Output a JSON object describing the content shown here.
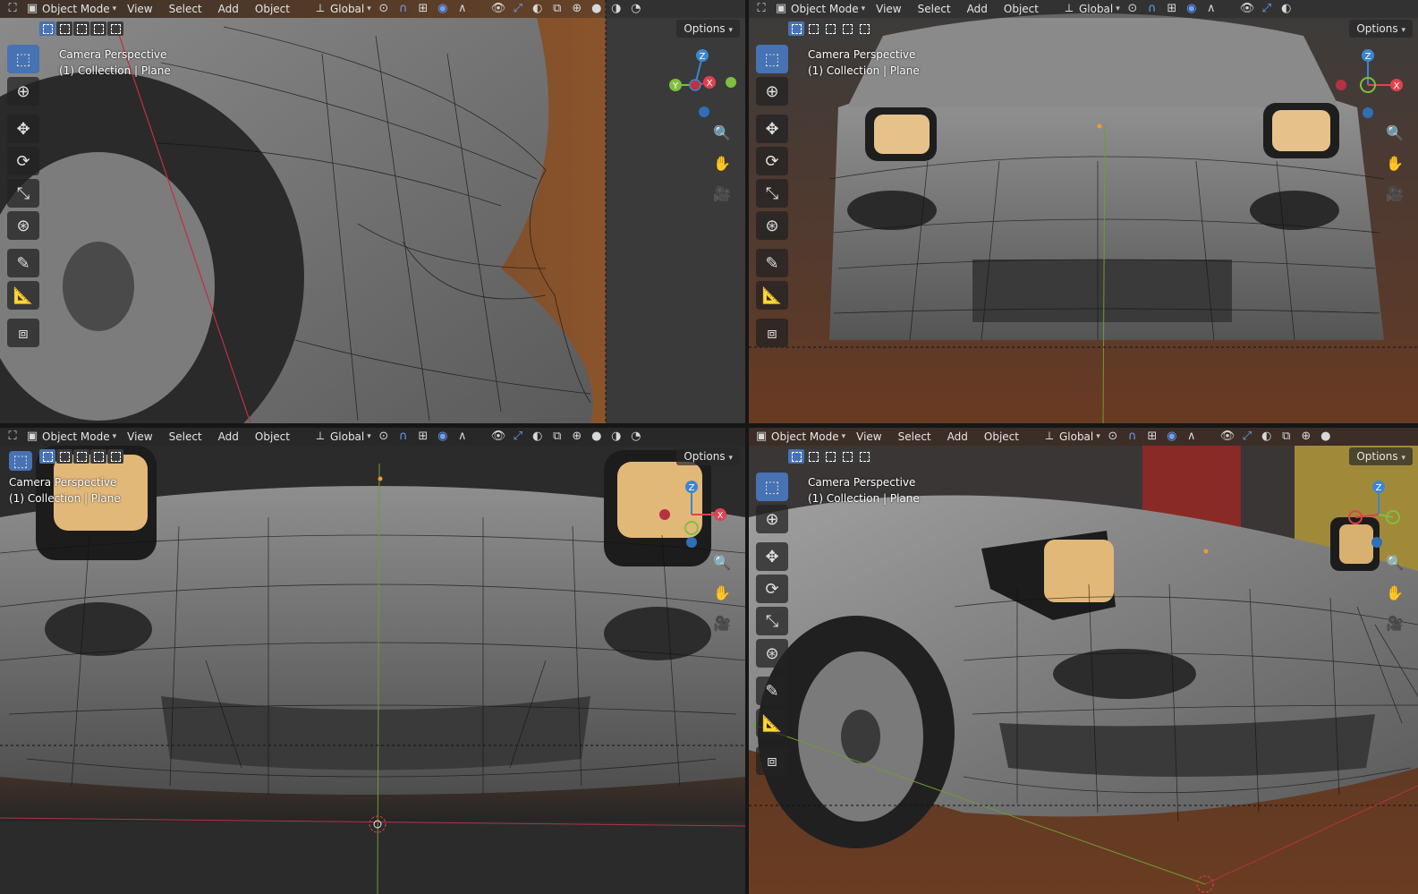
{
  "header": {
    "mode": "Object Mode",
    "menus": [
      "View",
      "Select",
      "Add",
      "Object"
    ],
    "orientation": "Global"
  },
  "viewport": {
    "options_label": "Options",
    "camera_label": "Camera Perspective",
    "collection_label": "(1) Collection | Plane"
  },
  "gizmo": {
    "x": "X",
    "y": "Y",
    "z": "Z"
  },
  "tools": [
    "select-box",
    "cursor",
    "move",
    "rotate",
    "scale",
    "transform",
    "annotate",
    "measure",
    "add-cube"
  ],
  "icons": [
    "zoom-icon",
    "hand-pan-icon",
    "camera-view-icon"
  ],
  "colors": {
    "active_tool": "#4772b3",
    "axis_x": "#e0424f",
    "axis_y": "#7fbf3f",
    "axis_z": "#3e85cf",
    "axis_line_green": "#6f9c2f",
    "axis_line_red": "#b43242"
  }
}
